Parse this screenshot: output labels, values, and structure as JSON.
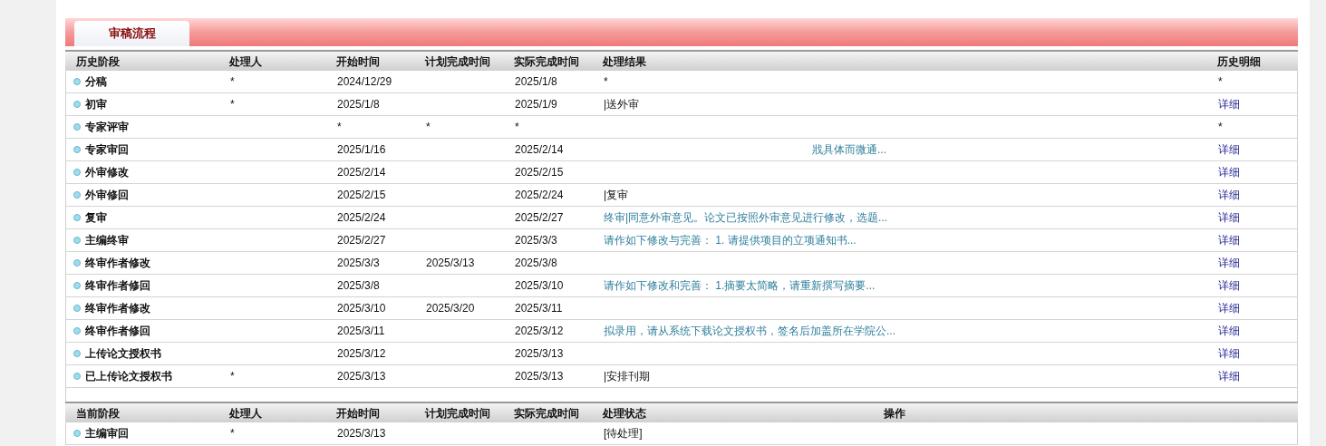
{
  "tabs": [
    {
      "label": "审稿流程",
      "selected": true
    }
  ],
  "history": {
    "columns": [
      "历史阶段",
      "处理人",
      "开始时间",
      "计划完成时间",
      "实际完成时间",
      "处理结果",
      "历史明细"
    ],
    "rows": [
      {
        "stage": "分稿",
        "handler": "*",
        "start": "2024/12/29",
        "actual": "2025/1/8",
        "result": {
          "text": "*",
          "kind": "plain"
        },
        "detail": {
          "text": "*",
          "kind": "plain"
        }
      },
      {
        "stage": "初审",
        "handler": "*",
        "start": "2025/1/8",
        "actual": "2025/1/9",
        "result": {
          "text": "|送外审",
          "kind": "plain"
        },
        "detail": {
          "text": "详细",
          "kind": "link"
        }
      },
      {
        "stage": "专家评审",
        "start": "*",
        "planned": "*",
        "actual": "*",
        "detail": {
          "text": "*",
          "kind": "plain"
        }
      },
      {
        "stage": "专家审回",
        "start": "2025/1/16",
        "actual": "2025/2/14",
        "result": {
          "text": "戕具体而微通...",
          "kind": "tail"
        },
        "detail": {
          "text": "详细",
          "kind": "link"
        }
      },
      {
        "stage": "外审修改",
        "start": "2025/2/14",
        "actual": "2025/2/15",
        "detail": {
          "text": "详细",
          "kind": "link"
        }
      },
      {
        "stage": "外审修回",
        "start": "2025/2/15",
        "actual": "2025/2/24",
        "result": {
          "text": "|复审",
          "kind": "plain"
        },
        "detail": {
          "text": "详细",
          "kind": "link"
        }
      },
      {
        "stage": "复审",
        "start": "2025/2/24",
        "actual": "2025/2/27",
        "result": {
          "text": "终审|同意外审意见。论文已按照外审意见进行修改，选题...",
          "kind": "note"
        },
        "detail": {
          "text": "详细",
          "kind": "link"
        }
      },
      {
        "stage": "主编终审",
        "start": "2025/2/27",
        "actual": "2025/3/3",
        "result": {
          "text": "请作如下修改与完善： 1. 请提供项目的立项通知书...",
          "kind": "note"
        },
        "detail": {
          "text": "详细",
          "kind": "link"
        }
      },
      {
        "stage": "终审作者修改",
        "start": "2025/3/3",
        "planned": "2025/3/13",
        "actual": "2025/3/8",
        "detail": {
          "text": "详细",
          "kind": "link"
        }
      },
      {
        "stage": "终审作者修回",
        "start": "2025/3/8",
        "actual": "2025/3/10",
        "result": {
          "text": "请作如下修改和完善： 1.摘要太简略，请重新撰写摘要...",
          "kind": "note"
        },
        "detail": {
          "text": "详细",
          "kind": "link"
        }
      },
      {
        "stage": "终审作者修改",
        "start": "2025/3/10",
        "planned": "2025/3/20",
        "actual": "2025/3/11",
        "detail": {
          "text": "详细",
          "kind": "link"
        }
      },
      {
        "stage": "终审作者修回",
        "start": "2025/3/11",
        "actual": "2025/3/12",
        "result": {
          "text": "拟录用，请从系统下载论文授权书，签名后加盖所在学院公...",
          "kind": "note"
        },
        "detail": {
          "text": "详细",
          "kind": "link"
        }
      },
      {
        "stage": "上传论文授权书",
        "start": "2025/3/12",
        "actual": "2025/3/13",
        "detail": {
          "text": "详细",
          "kind": "link"
        }
      },
      {
        "stage": "已上传论文授权书",
        "handler": "*",
        "start": "2025/3/13",
        "actual": "2025/3/13",
        "result": {
          "text": "|安排刊期",
          "kind": "plain"
        },
        "detail": {
          "text": "详细",
          "kind": "link"
        }
      }
    ]
  },
  "current": {
    "columns": [
      "当前阶段",
      "处理人",
      "开始时间",
      "计划完成时间",
      "实际完成时间",
      "处理状态",
      "操作"
    ],
    "rows": [
      {
        "stage": "主编审回",
        "handler": "*",
        "start": "2025/3/13",
        "status": "[待处理]"
      }
    ]
  }
}
